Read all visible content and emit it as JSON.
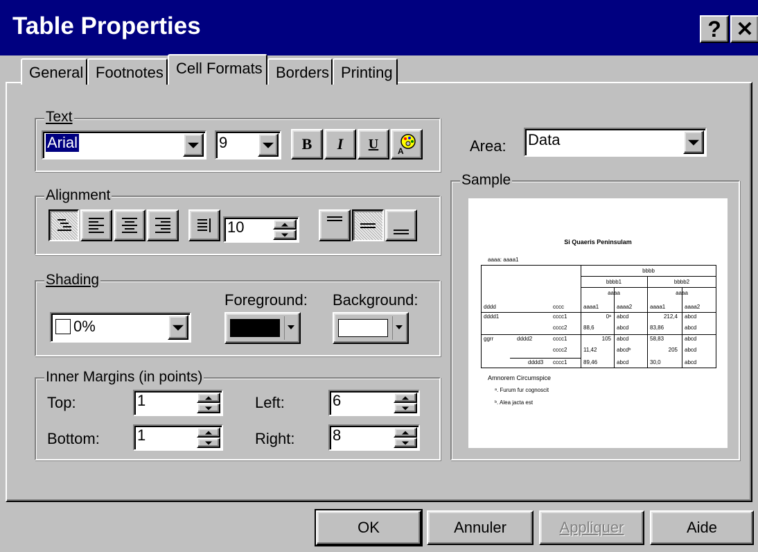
{
  "window": {
    "title": "Table Properties",
    "help_btn": "?",
    "close_btn": "✕"
  },
  "tabs": [
    {
      "label": "General",
      "active": false
    },
    {
      "label": "Footnotes",
      "active": false
    },
    {
      "label": "Cell Formats",
      "active": true
    },
    {
      "label": "Borders",
      "active": false
    },
    {
      "label": "Printing",
      "active": false
    }
  ],
  "text_group": {
    "legend": "Text",
    "font": "Arial",
    "size": "9",
    "bold": "B",
    "italic": "I",
    "underline": "U"
  },
  "alignment_group": {
    "legend": "Alignment",
    "indent_value": "10"
  },
  "shading_group": {
    "legend": "Shading",
    "percent": "0%",
    "foreground_label": "Foreground:",
    "background_label": "Background:",
    "foreground_color": "#000000",
    "background_color": "#ffffff"
  },
  "margins_group": {
    "legend": "Inner Margins (in points)",
    "top_label": "Top:",
    "top_value": "1",
    "bottom_label": "Bottom:",
    "bottom_value": "1",
    "left_label": "Left:",
    "left_value": "6",
    "right_label": "Right:",
    "right_value": "8"
  },
  "area": {
    "label": "Area:",
    "value": "Data"
  },
  "sample": {
    "legend": "Sample",
    "table_title": "Si Quaeris Peninsulam",
    "layer": "aaaa: aaaa1",
    "header_top": "bbbb",
    "header_b1": "bbbb1",
    "header_b2": "bbbb2",
    "header_aaaa": "aaaa",
    "corner_d": "dddd",
    "corner_c": "cccc",
    "col_aaaa1": "aaaa1",
    "col_aaaa2": "aaaa2",
    "rows": [
      {
        "r1": "dddd1",
        "r2": "",
        "c": "cccc1",
        "v1": "0ᵃ",
        "v2": "abcd",
        "v3": "212,4",
        "v4": "abcd"
      },
      {
        "r1": "",
        "r2": "",
        "c": "cccc2",
        "v1": "88,6",
        "v2": "abcd",
        "v3": "83,86",
        "v4": "abcd"
      },
      {
        "r1": "ggrr",
        "r2": "dddd2",
        "c": "cccc1",
        "v1": "105",
        "v2": "abcd",
        "v3": "58,83",
        "v4": "abcd"
      },
      {
        "r1": "",
        "r2": "",
        "c": "cccc2",
        "v1": "11,42",
        "v2": "abcdᵇ",
        "v3": "205",
        "v4": "abcd"
      },
      {
        "r1": "",
        "r2": "dddd3",
        "c": "cccc1",
        "v1": "89,46",
        "v2": "abcd",
        "v3": "30,0",
        "v4": "abcd"
      }
    ],
    "caption": "Amnorem Circumspice",
    "footnote_a": "ᵃ. Furum fur cognoscit",
    "footnote_b": "ᵇ. Alea jacta est"
  },
  "buttons": {
    "ok": "OK",
    "cancel": "Annuler",
    "apply": "Appliquer",
    "help": "Aide"
  }
}
